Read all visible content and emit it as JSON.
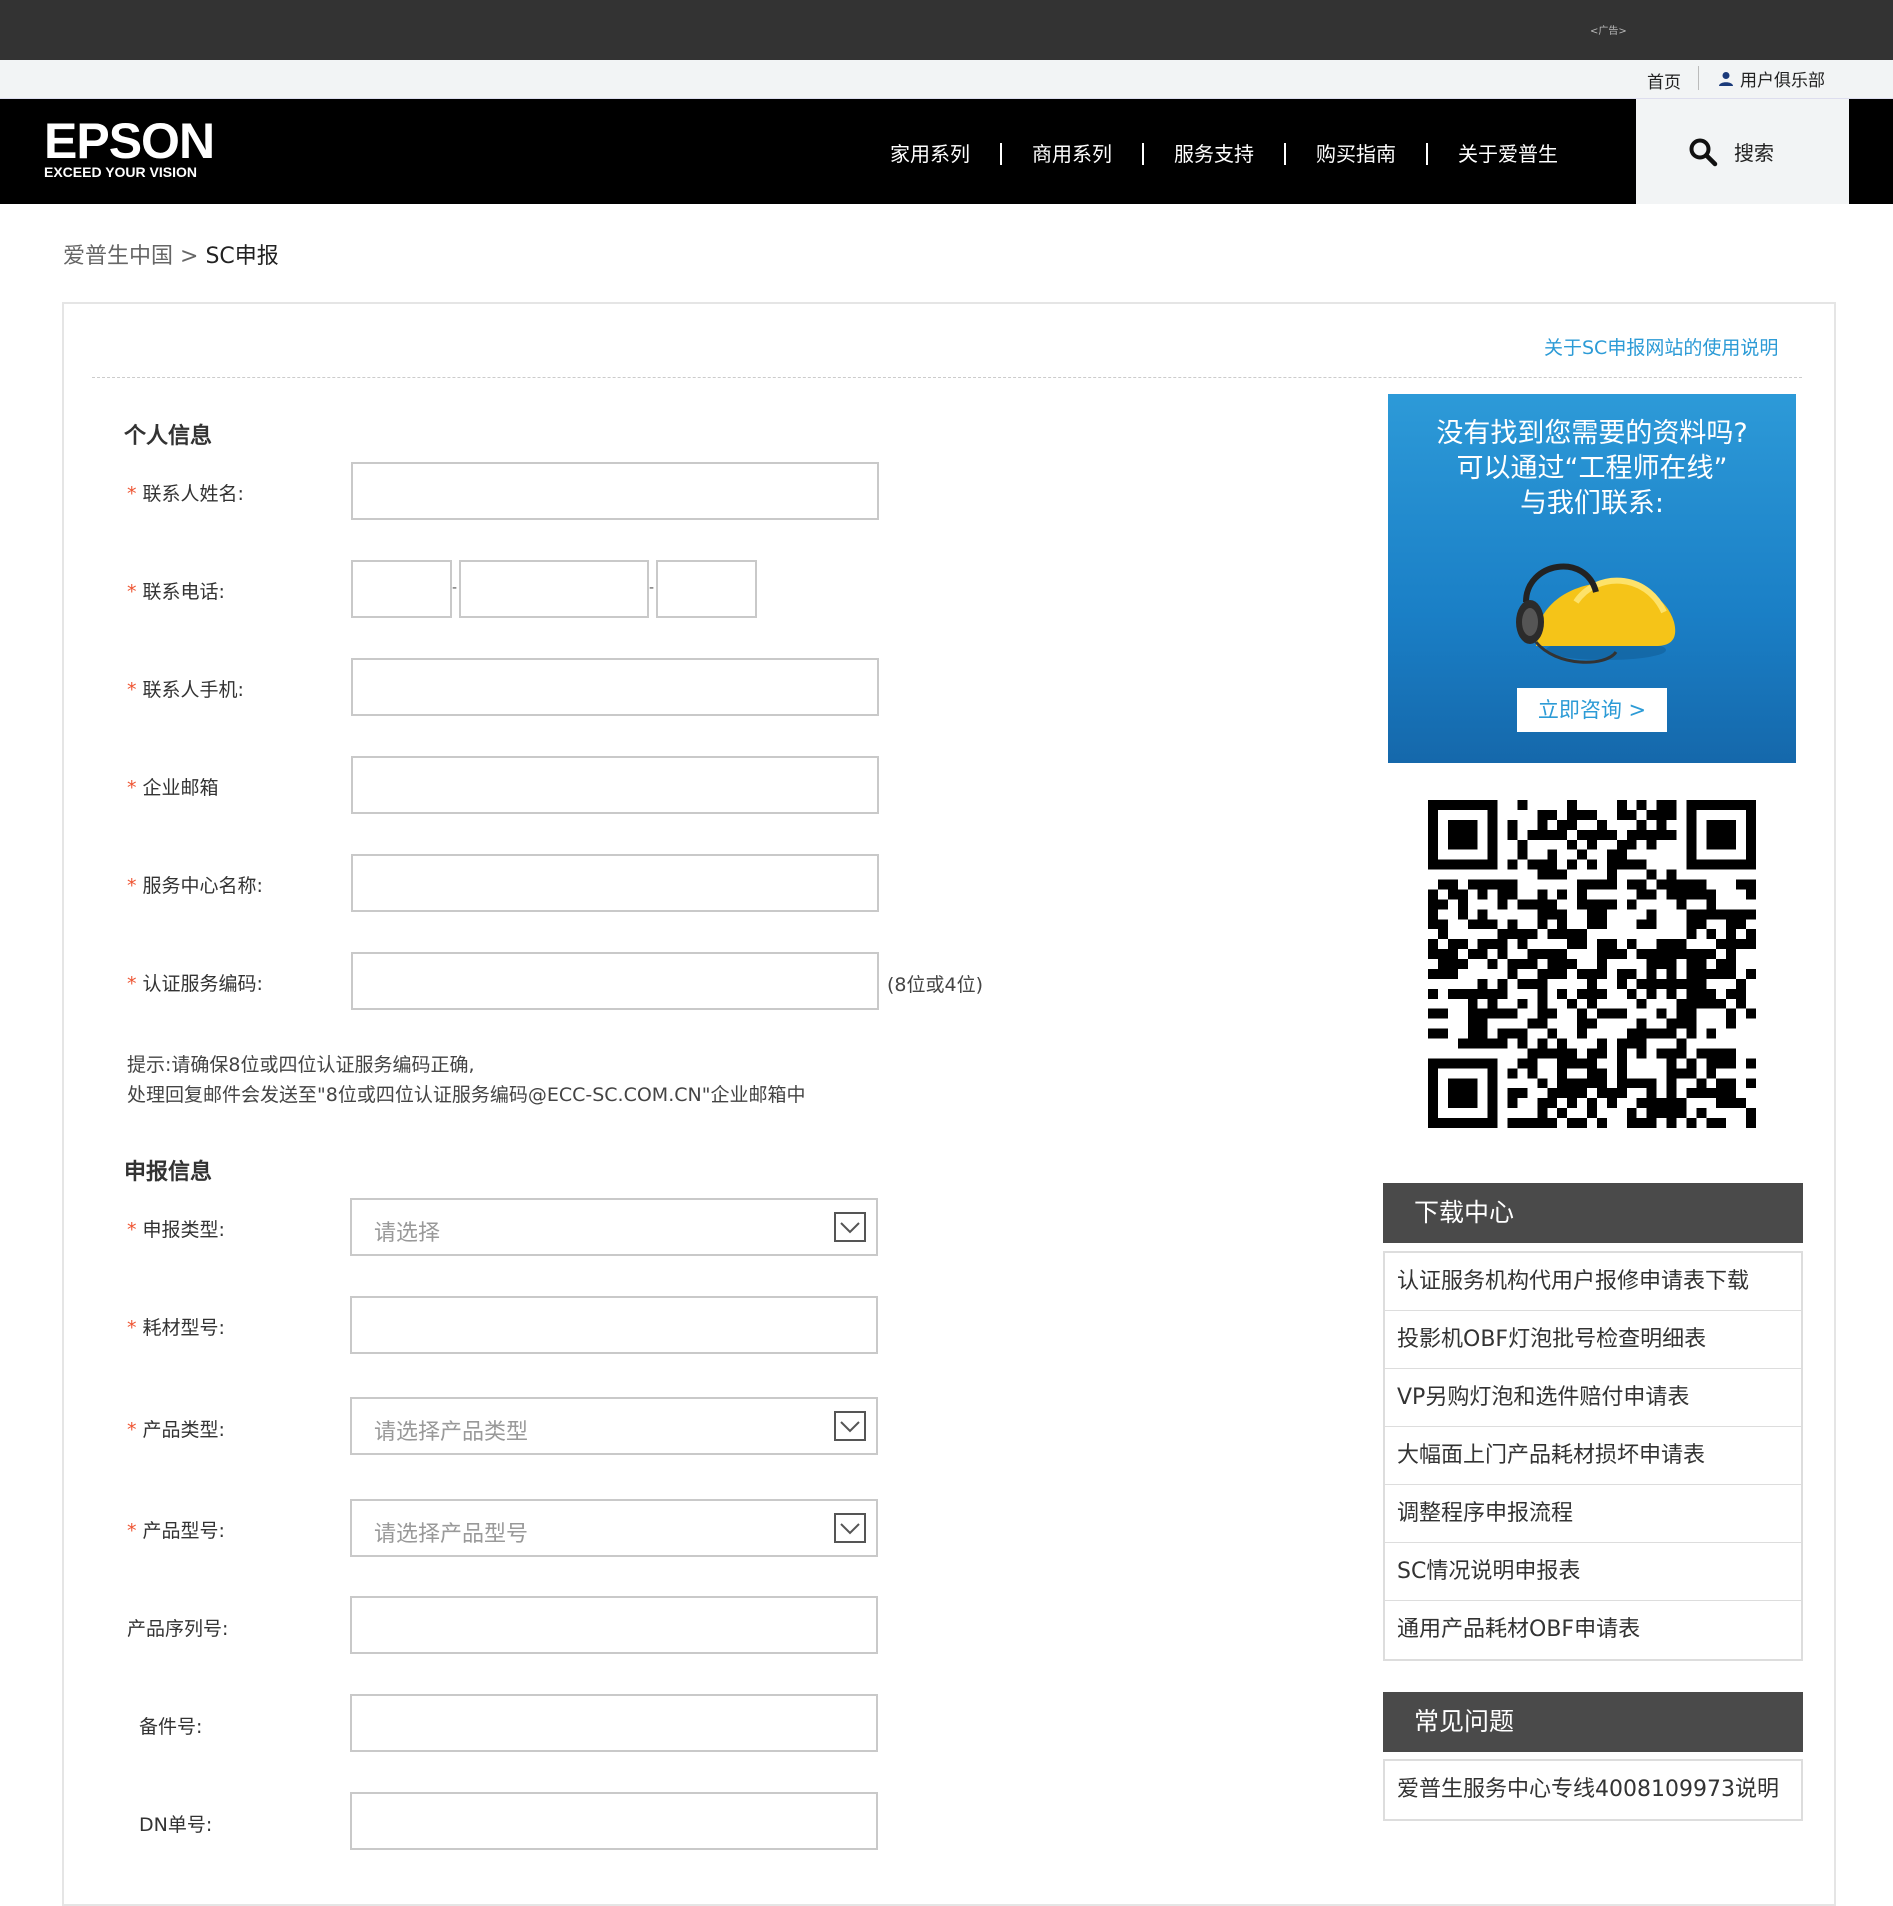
{
  "ad": {
    "label": "<广告>"
  },
  "util": {
    "home": "首页",
    "club": "用户俱乐部"
  },
  "logo": {
    "brand": "EPSON",
    "tagline": "EXCEED YOUR VISION"
  },
  "nav": {
    "items": [
      "家用系列",
      "商用系列",
      "服务支持",
      "购买指南",
      "关于爱普生"
    ],
    "search": "搜索"
  },
  "breadcrumb": {
    "home": "爱普生中国",
    "sep": ">",
    "current": "SC申报"
  },
  "help_link": "关于SC申报网站的使用说明",
  "personal": {
    "title": "个人信息",
    "required_mark": "*",
    "name_label": "联系人姓名:",
    "phone_label": "联系电话:",
    "phone_sep": "-",
    "mobile_label": "联系人手机:",
    "email_label": "企业邮箱",
    "center_label": "服务中心名称:",
    "code_label": "认证服务编码:",
    "code_hint": "(8位或4位)",
    "tip_line1": "提示:请确保8位或四位认证服务编码正确,",
    "tip_line2": "处理回复邮件会发送至\"8位或四位认证服务编码@ECC-SC.COM.CN\"企业邮箱中"
  },
  "report": {
    "title": "申报信息",
    "type_label": "申报类型:",
    "type_placeholder": "请选择",
    "consumable_label": "耗材型号:",
    "product_type_label": "产品类型:",
    "product_type_placeholder": "请选择产品类型",
    "product_model_label": "产品型号:",
    "product_model_placeholder": "请选择产品型号",
    "serial_label": "产品序列号:",
    "part_label": "备件号:",
    "dn_label": "DN单号:"
  },
  "promo": {
    "line1": "没有找到您需要的资料吗?",
    "line2": "可以通过“工程师在线”",
    "line3": "与我们联系:",
    "button": "立即咨询 >"
  },
  "downloads": {
    "title": "下载中心",
    "items": [
      "认证服务机构代用户报修申请表下载",
      "投影机OBF灯泡批号检查明细表",
      "VP另购灯泡和选件赔付申请表",
      "大幅面上门产品耗材损坏申请表",
      "调整程序申报流程",
      "SC情况说明申报表",
      "通用产品耗材OBF申请表"
    ]
  },
  "faq": {
    "title": "常见问题",
    "items": [
      "爱普生服务中心专线4008109973说明"
    ]
  },
  "colors": {
    "accent": "#2c9bd6",
    "header_bg": "#000000",
    "required": "#ee5533"
  }
}
